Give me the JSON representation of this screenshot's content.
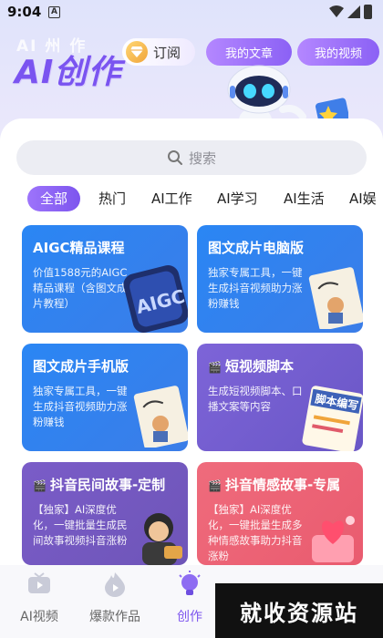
{
  "status": {
    "time": "9:04",
    "notif_letter": "A"
  },
  "hero": {
    "bg_text": "AI 州 作",
    "title": "AI创作",
    "subscribe": "订阅"
  },
  "header": {
    "my_articles": "我的文章",
    "my_videos": "我的视频"
  },
  "search": {
    "placeholder": "搜索"
  },
  "categories": [
    "全部",
    "热门",
    "AI工作",
    "AI学习",
    "AI生活",
    "AI娱"
  ],
  "cards": [
    {
      "title": "AIGC精品课程",
      "desc": "价值1588元的AIGC精品课程（含图文成片教程）",
      "color": "#2a86f4"
    },
    {
      "title": "图文成片电脑版",
      "desc": "独家专属工具，一键生成抖音视频助力涨粉赚钱",
      "color": "#2a86f4"
    },
    {
      "title": "图文成片手机版",
      "desc": "独家专属工具，一键生成抖音视频助力涨粉赚钱",
      "color": "#2a86f4"
    },
    {
      "title": "短视频脚本",
      "desc": "生成短视频脚本、口播文案等内容",
      "color": "#7d64d8"
    },
    {
      "title": "抖音民间故事-定制",
      "desc": "【独家】AI深度优化，一键批量生成民间故事视频抖音涨粉",
      "color": "#7a5cc8"
    },
    {
      "title": "抖音情感故事-专属",
      "desc": "【独家】AI深度优化，一键批量生成多种情感故事助力抖音涨粉",
      "color": "#ef6b7c"
    }
  ],
  "art": {
    "aigc": "AIGC",
    "book": "脚本编写"
  },
  "tabs": [
    "AI视频",
    "爆款作品",
    "创作"
  ],
  "watermark": "就收资源站"
}
